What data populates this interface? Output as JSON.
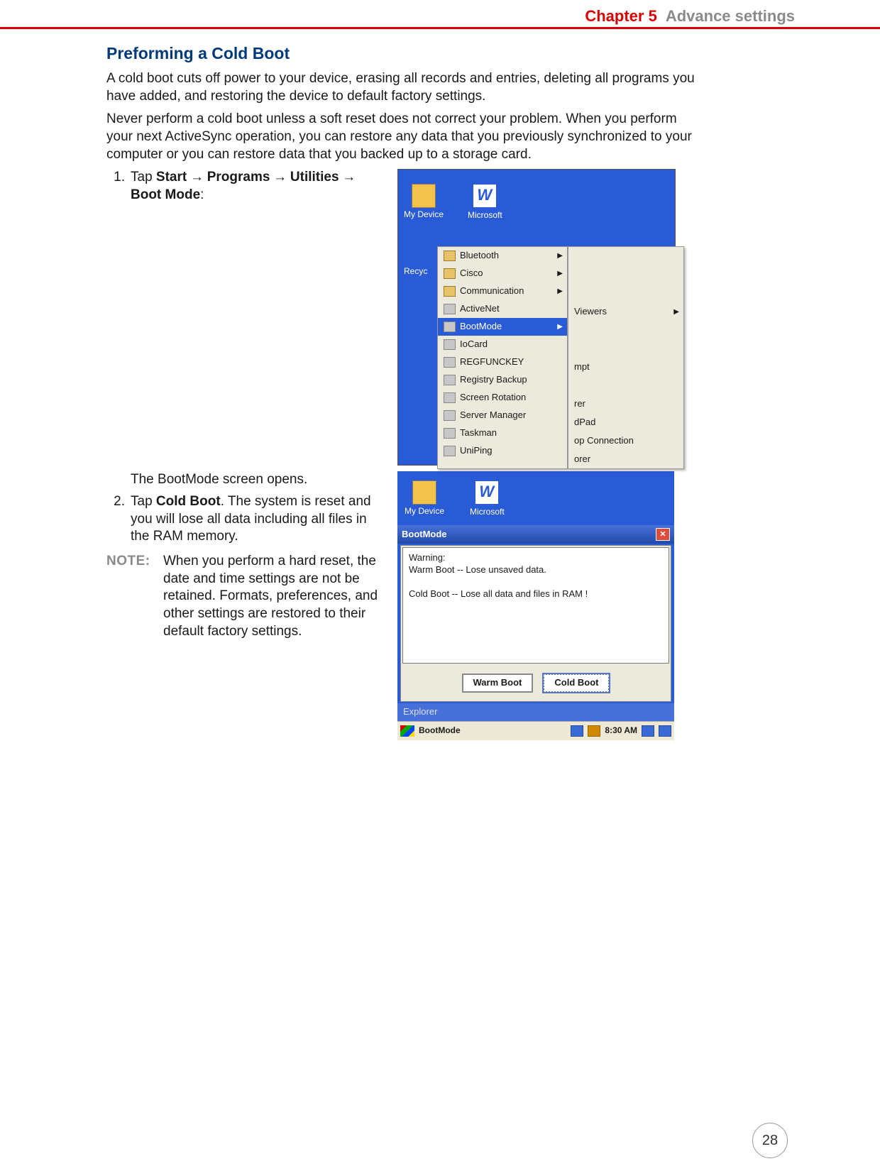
{
  "header": {
    "chapter": "Chapter 5",
    "section": "Advance settings"
  },
  "title": "Preforming a Cold Boot",
  "para1": "A cold boot cuts off power to your device, erasing all records and entries, deleting all programs you have added, and restoring the device to default factory settings.",
  "para2": "Never perform a cold boot unless a soft reset does not correct your problem. When you perform your next ActiveSync operation, you can restore any data that you previously synchronized to your computer or you can restore data that you backed up to a storage card.",
  "step1": {
    "num": "1.",
    "pre": "Tap ",
    "b1": "Start",
    "b2": "Programs",
    "b3": "Utilities",
    "b4": "Boot Mode",
    "tail": ":"
  },
  "arrow": " → ",
  "bootline": "The BootMode screen opens.",
  "step2": {
    "num": "2.",
    "pre": "Tap ",
    "b": "Cold Boot",
    "tail": ". The system is reset and you will lose all data including all files in the RAM memory."
  },
  "note": {
    "label": "NOTE:",
    "text": "When you perform a hard reset, the date and time settings are not be retained. Formats, preferences, and other settings are restored to their default factory settings."
  },
  "shot1": {
    "desk": [
      {
        "label": "My Device"
      },
      {
        "label": "Microsoft"
      }
    ],
    "recycle": "Recyc",
    "left": [
      {
        "label": "Bluetooth",
        "folder": true,
        "sub": true
      },
      {
        "label": "Cisco",
        "folder": true,
        "sub": true
      },
      {
        "label": "Communication",
        "folder": true,
        "sub": true
      },
      {
        "label": "ActiveNet"
      },
      {
        "label": "BootMode",
        "sel": true,
        "sub": true
      },
      {
        "label": "IoCard"
      },
      {
        "label": "REGFUNCKEY"
      },
      {
        "label": "Registry Backup"
      },
      {
        "label": "Screen Rotation"
      },
      {
        "label": "Server Manager"
      },
      {
        "label": "Taskman"
      },
      {
        "label": "UniPing"
      }
    ],
    "right": [
      {
        "label": ""
      },
      {
        "label": ""
      },
      {
        "label": ""
      },
      {
        "label": "Viewers",
        "sub": true
      },
      {
        "label": ""
      },
      {
        "label": ""
      },
      {
        "label": "mpt"
      },
      {
        "label": ""
      },
      {
        "label": "rer"
      },
      {
        "label": "dPad"
      },
      {
        "label": "op Connection"
      },
      {
        "label": "orer"
      }
    ]
  },
  "shot2": {
    "desk": [
      {
        "label": "My Device"
      },
      {
        "label": "Microsoft"
      }
    ],
    "title": "BootMode",
    "warning_hdr": "Warning:",
    "warning_l1": "Warm Boot -- Lose unsaved data.",
    "warning_l2": "Cold Boot -- Lose all data and files in RAM !",
    "btn_warm": "Warm Boot",
    "btn_cold": "Cold Boot",
    "explorer": "Explorer",
    "task_name": "BootMode",
    "task_time": "8:30 AM"
  },
  "page_number": "28"
}
